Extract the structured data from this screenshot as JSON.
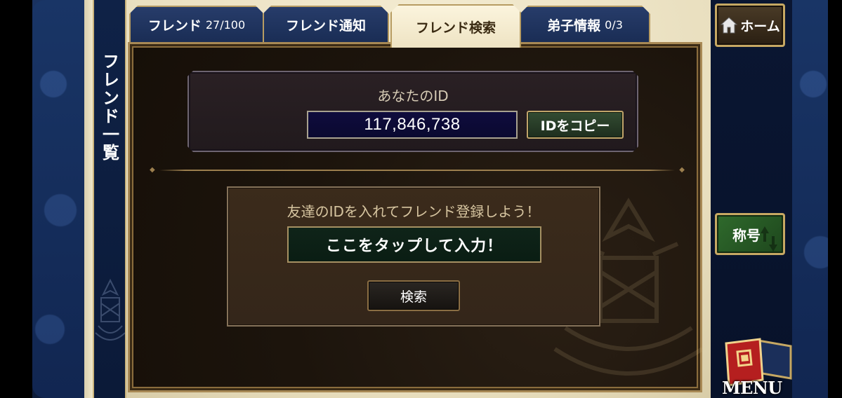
{
  "sidebar": {
    "title": "フレンド一覧"
  },
  "tabs": [
    {
      "label": "フレンド",
      "count": "27/100",
      "active": false
    },
    {
      "label": "フレンド通知",
      "count": "",
      "active": false
    },
    {
      "label": "フレンド検索",
      "count": "",
      "active": true
    },
    {
      "label": "弟子情報",
      "count": "0/3",
      "active": false
    }
  ],
  "my_id": {
    "label": "あなたのID",
    "value": "117,846,738",
    "copy_button": "IDをコピー"
  },
  "friend_search": {
    "prompt": "友達のIDを入れてフレンド登録しよう！",
    "input_placeholder": "ここをタップして入力！",
    "search_button": "検索"
  },
  "right_menu": {
    "home_label": "ホーム",
    "title_label": "称号",
    "menu_label": "MENU"
  },
  "colors": {
    "tab_blue": "#1a2d55",
    "panel_brown": "#1c140c",
    "gold_border": "#b79c62",
    "copy_green": "#334c32",
    "id_navy": "#0f0c3d"
  }
}
